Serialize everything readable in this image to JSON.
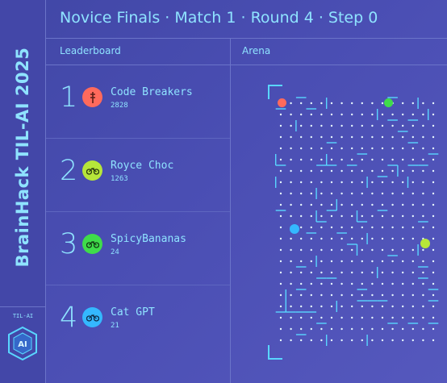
{
  "brand": {
    "title": "BrainHack TIL-AI 2025",
    "small_label": "TIL-AI",
    "logo_text": "AI"
  },
  "header": {
    "title": "Novice Finals · Match 1 · Round 4 · Step 0"
  },
  "columns": {
    "leaderboard": "Leaderboard",
    "arena": "Arena"
  },
  "leaderboard": [
    {
      "rank": "1",
      "name": "Code Breakers",
      "score": "2828",
      "color": "#ff6a5c",
      "icon": "pin-icon"
    },
    {
      "rank": "2",
      "name": "Royce Choc",
      "score": "1263",
      "color": "#b6e63a",
      "icon": "bicycle-icon"
    },
    {
      "rank": "3",
      "name": "SpicyBananas",
      "score": "24",
      "color": "#3fdc4a",
      "icon": "bicycle-icon"
    },
    {
      "rank": "4",
      "name": "Cat GPT",
      "score": "21",
      "color": "#34b8ff",
      "icon": "bicycle-icon"
    }
  ],
  "colors": {
    "background": "#4347a8",
    "accent": "#8fe3ff",
    "maze_wall": "#59d6ff"
  }
}
